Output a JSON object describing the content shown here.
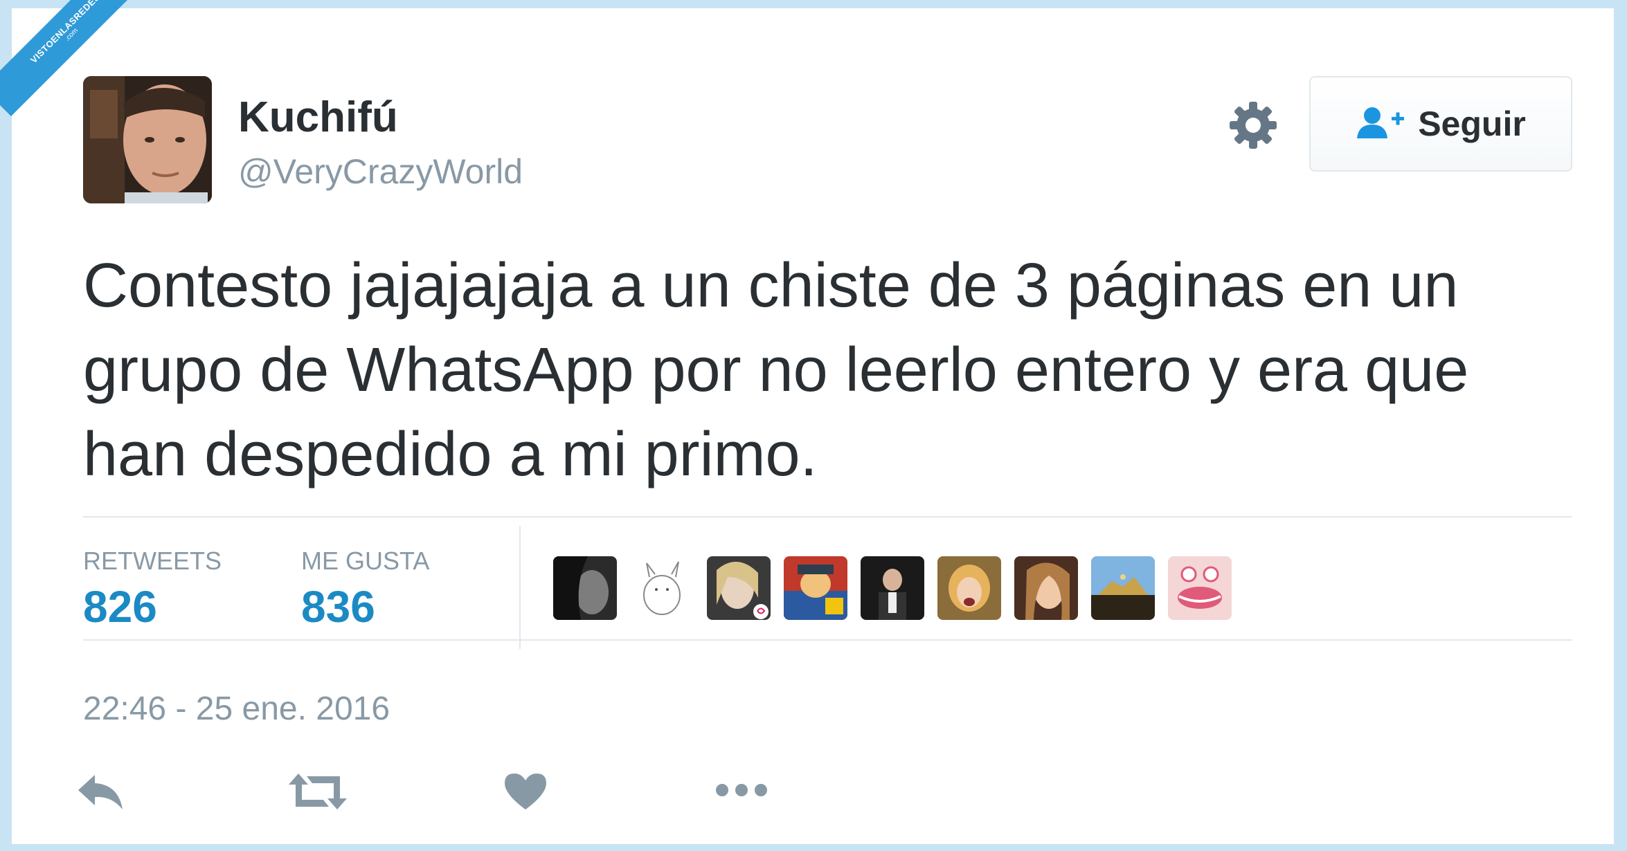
{
  "watermark": {
    "line1": "VISTOENLASREDES",
    "line2": ".com"
  },
  "user": {
    "name": "Kuchifú",
    "handle": "@VeryCrazyWorld"
  },
  "header": {
    "settings_icon": "gear-icon",
    "follow_label": "Seguir",
    "follow_icon": "add-user-icon"
  },
  "tweet": {
    "text": "Contesto jajajajaja a un chiste de 3 páginas en un grupo de WhatsApp por no leerlo entero y era que han despedido a mi primo."
  },
  "stats": {
    "retweets_label": "RETWEETS",
    "retweets_value": "826",
    "likes_label": "ME GUSTA",
    "likes_value": "836"
  },
  "timestamp": "22:46 - 25 ene. 2016",
  "actions": [
    "reply-icon",
    "retweet-icon",
    "like-icon",
    "more-icon"
  ],
  "colors": {
    "accent": "#1b8ac4",
    "muted": "#8899a6",
    "text": "#292f33",
    "frame": "#c8e3f4"
  }
}
